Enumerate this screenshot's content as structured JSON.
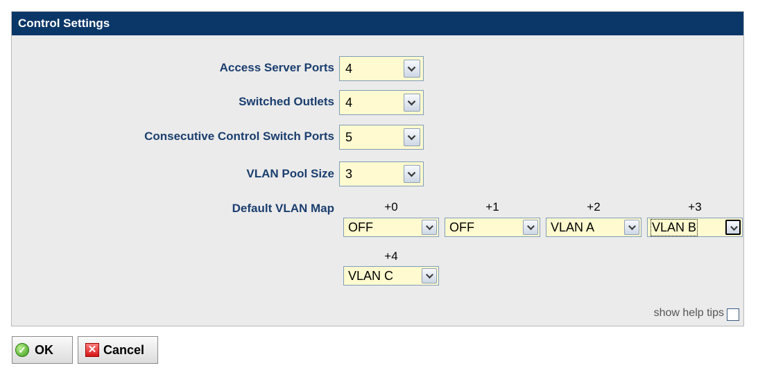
{
  "panel": {
    "title": "Control Settings"
  },
  "fields": {
    "access_server_ports": {
      "label": "Access Server Ports",
      "value": "4"
    },
    "switched_outlets": {
      "label": "Switched Outlets",
      "value": "4"
    },
    "consecutive_control_switch_ports": {
      "label": "Consecutive Control Switch Ports",
      "value": "5"
    },
    "vlan_pool_size": {
      "label": "VLAN Pool Size",
      "value": "3"
    }
  },
  "vlan_map": {
    "label": "Default VLAN Map",
    "entries": [
      {
        "offset": "+0",
        "value": "OFF"
      },
      {
        "offset": "+1",
        "value": "OFF"
      },
      {
        "offset": "+2",
        "value": "VLAN A"
      },
      {
        "offset": "+3",
        "value": "VLAN B"
      },
      {
        "offset": "+4",
        "value": "VLAN C"
      }
    ]
  },
  "help": {
    "label": "show help tips"
  },
  "actions": {
    "ok": "OK",
    "cancel": "Cancel"
  },
  "colors": {
    "header": "#0b3768",
    "label": "#1a3e6e",
    "field": "#fffacf",
    "panel": "#ebebeb"
  }
}
